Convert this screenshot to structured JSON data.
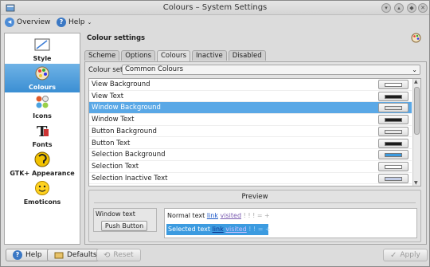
{
  "window": {
    "title": "Colours – System Settings"
  },
  "toolbar": {
    "overview_label": "Overview",
    "help_label": "Help"
  },
  "sidebar": {
    "items": [
      {
        "label": "Style"
      },
      {
        "label": "Colours"
      },
      {
        "label": "Icons"
      },
      {
        "label": "Fonts"
      },
      {
        "label": "GTK+ Appearance"
      },
      {
        "label": "Emoticons"
      }
    ]
  },
  "main": {
    "heading": "Colour settings",
    "tabs": [
      "Scheme",
      "Options",
      "Colours",
      "Inactive",
      "Disabled"
    ],
    "colour_set_label": "Colour set:",
    "colour_set_value": "Common Colours",
    "rows": [
      {
        "label": "View Background",
        "color": "#ffffff"
      },
      {
        "label": "View Text",
        "color": "#1c1c1c"
      },
      {
        "label": "Window Background",
        "color": "#e2e2e2"
      },
      {
        "label": "Window Text",
        "color": "#1c1c1c"
      },
      {
        "label": "Button Background",
        "color": "#e8e8e8"
      },
      {
        "label": "Button Text",
        "color": "#1c1c1c"
      },
      {
        "label": "Selection Background",
        "color": "#3c9be0"
      },
      {
        "label": "Selection Text",
        "color": "#ffffff"
      },
      {
        "label": "Selection Inactive Text",
        "color": "#c3cde6"
      }
    ],
    "preview": {
      "title": "Preview",
      "window_text": "Window text",
      "push_button": "Push Button",
      "normal_text": "Normal text",
      "link": "link",
      "visited": "visited",
      "extra": "! ! ! = +",
      "selected_text": "Selected text",
      "sel_link": "link",
      "sel_visited": "visited",
      "sel_extra": "! ! = +"
    }
  },
  "buttons": {
    "help": "Help",
    "defaults": "Defaults",
    "reset": "Reset",
    "apply": "Apply"
  }
}
